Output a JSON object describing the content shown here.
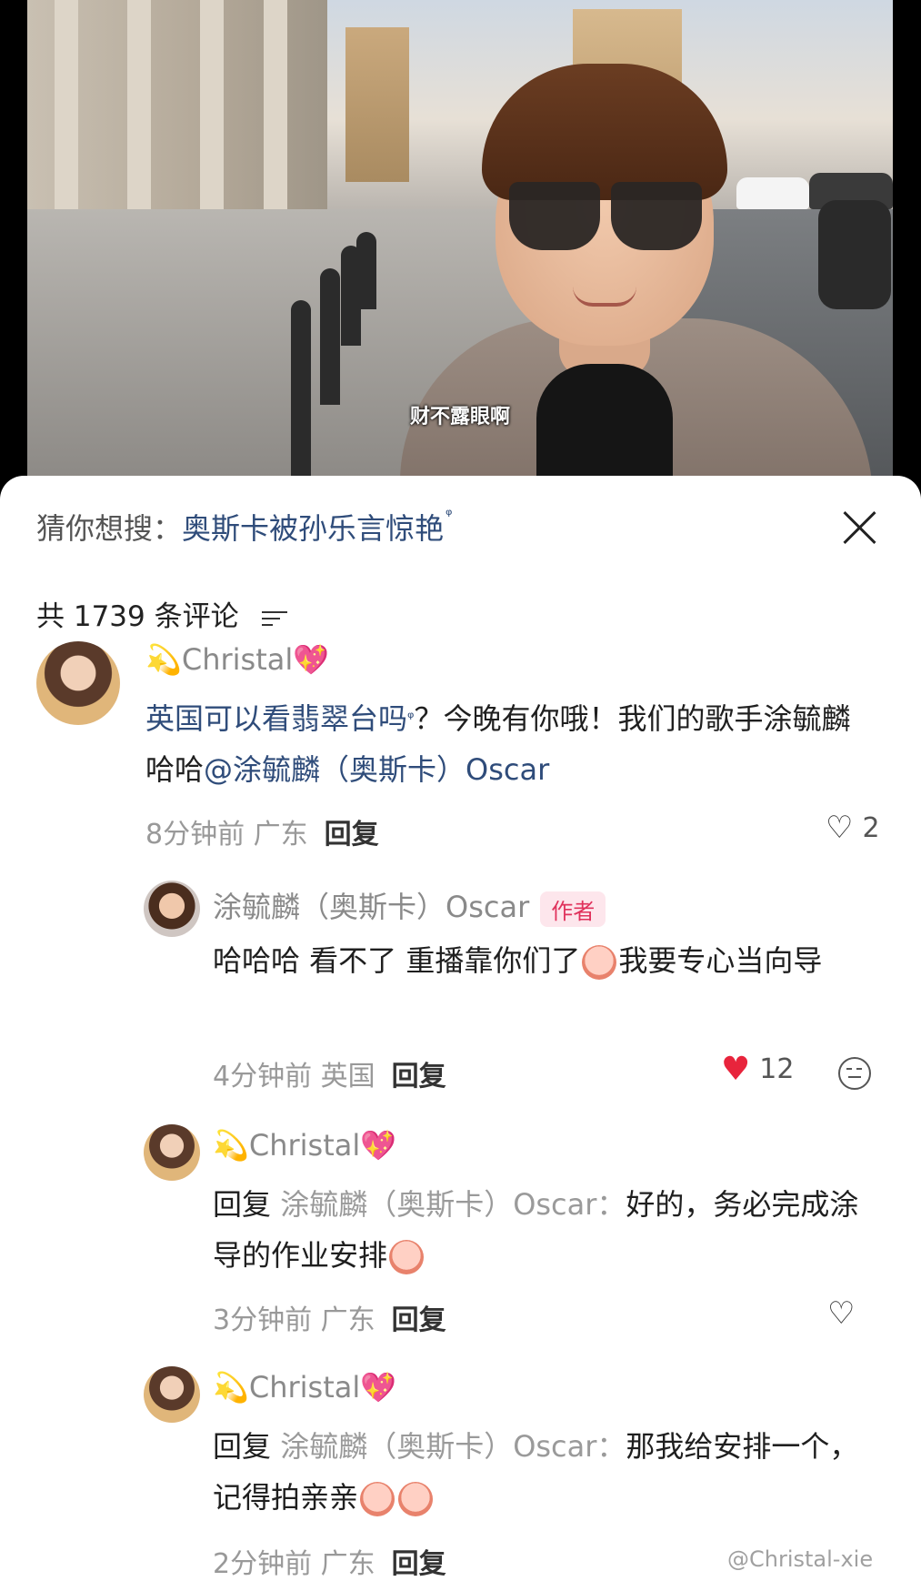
{
  "video": {
    "subtitle": "财不露眼啊"
  },
  "suggestion": {
    "prefix": "猜你想搜：",
    "query": "奥斯卡被孙乐言惊艳",
    "search_mark": "ᵠ"
  },
  "comments_header": {
    "count_label": "共 1739 条评论"
  },
  "comments": [
    {
      "user_prefix_emoji": "💫",
      "username": "Christal",
      "user_suffix_emoji": "💖",
      "text_a": "英国可以看翡翠台吗",
      "mark": "ᵠ",
      "text_b": "？今晚有你哦！我们的歌手涂毓麟哈哈",
      "mention": "@涂毓麟（奥斯卡）Oscar",
      "time": "8分钟前",
      "location": "广东",
      "reply_label": "回复",
      "likes": "2"
    },
    {
      "username": "涂毓麟（奥斯卡）Oscar",
      "badge": "作者",
      "text_a": "哈哈哈 看不了 重播靠你们了",
      "text_b": "我要专心当向导",
      "time": "4分钟前",
      "location": "英国",
      "reply_label": "回复",
      "likes": "12"
    },
    {
      "user_prefix_emoji": "💫",
      "username": "Christal",
      "user_suffix_emoji": "💖",
      "reply_prefix": "回复",
      "reply_to": "涂毓麟（奥斯卡）Oscar：",
      "text_a": "好的，务必完成涂导的作业安排",
      "time": "3分钟前",
      "location": "广东",
      "reply_label": "回复"
    },
    {
      "user_prefix_emoji": "💫",
      "username": "Christal",
      "user_suffix_emoji": "💖",
      "reply_prefix": "回复",
      "reply_to": "涂毓麟（奥斯卡）Oscar：",
      "text_a": "那我给安排一个，记得拍亲亲",
      "time": "2分钟前",
      "location": "广东",
      "reply_label": "回复"
    }
  ],
  "watermark": "@Christal-xie",
  "icons": {
    "close": "close-icon",
    "filter": "filter-icon",
    "heart_outline": "heart-outline-icon",
    "heart_filled": "heart-filled-icon",
    "dislike": "dislike-face-icon"
  },
  "colors": {
    "link": "#2f4c7a",
    "like_red": "#e8243c",
    "author_badge": "#e0325c"
  }
}
